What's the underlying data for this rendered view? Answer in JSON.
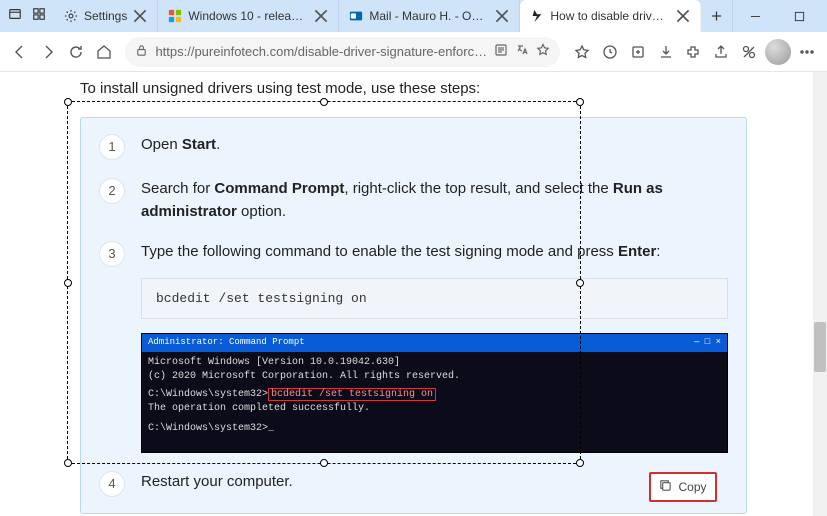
{
  "titlebar": {
    "tabs": [
      {
        "label": "Settings",
        "favicon": "gear"
      },
      {
        "label": "Windows 10 - release inf…",
        "favicon": "ms"
      },
      {
        "label": "Mail - Mauro H. - Outlook",
        "favicon": "outlook"
      },
      {
        "label": "How to disable driver sig…",
        "favicon": "page",
        "active": true
      }
    ]
  },
  "toolbar": {
    "url": "https://pureinfotech.com/disable-driver-signature-enforc…"
  },
  "page": {
    "intro": "To install unsigned drivers using test mode, use these steps:",
    "steps": [
      {
        "n": "1",
        "html": "Open <b>Start</b>."
      },
      {
        "n": "2",
        "html": "Search for <b>Command Prompt</b>, right-click the top result, and select the <b>Run as administrator</b> option."
      },
      {
        "n": "3",
        "html": "Type the following command to enable the test signing mode and press <b>Enter</b>:"
      },
      {
        "n": "4",
        "html": "Restart your computer."
      }
    ],
    "code": "bcdedit /set testsigning on",
    "cmd": {
      "title": "Administrator: Command Prompt",
      "line1": "Microsoft Windows [Version 10.0.19042.630]",
      "line2": "(c) 2020 Microsoft Corporation. All rights reserved.",
      "line3_prefix": "C:\\Windows\\system32>",
      "line3_cmd": "bcdedit /set testsigning on",
      "line4": "The operation completed successfully.",
      "line5": "C:\\Windows\\system32>_"
    }
  },
  "copy": {
    "label": "Copy"
  }
}
